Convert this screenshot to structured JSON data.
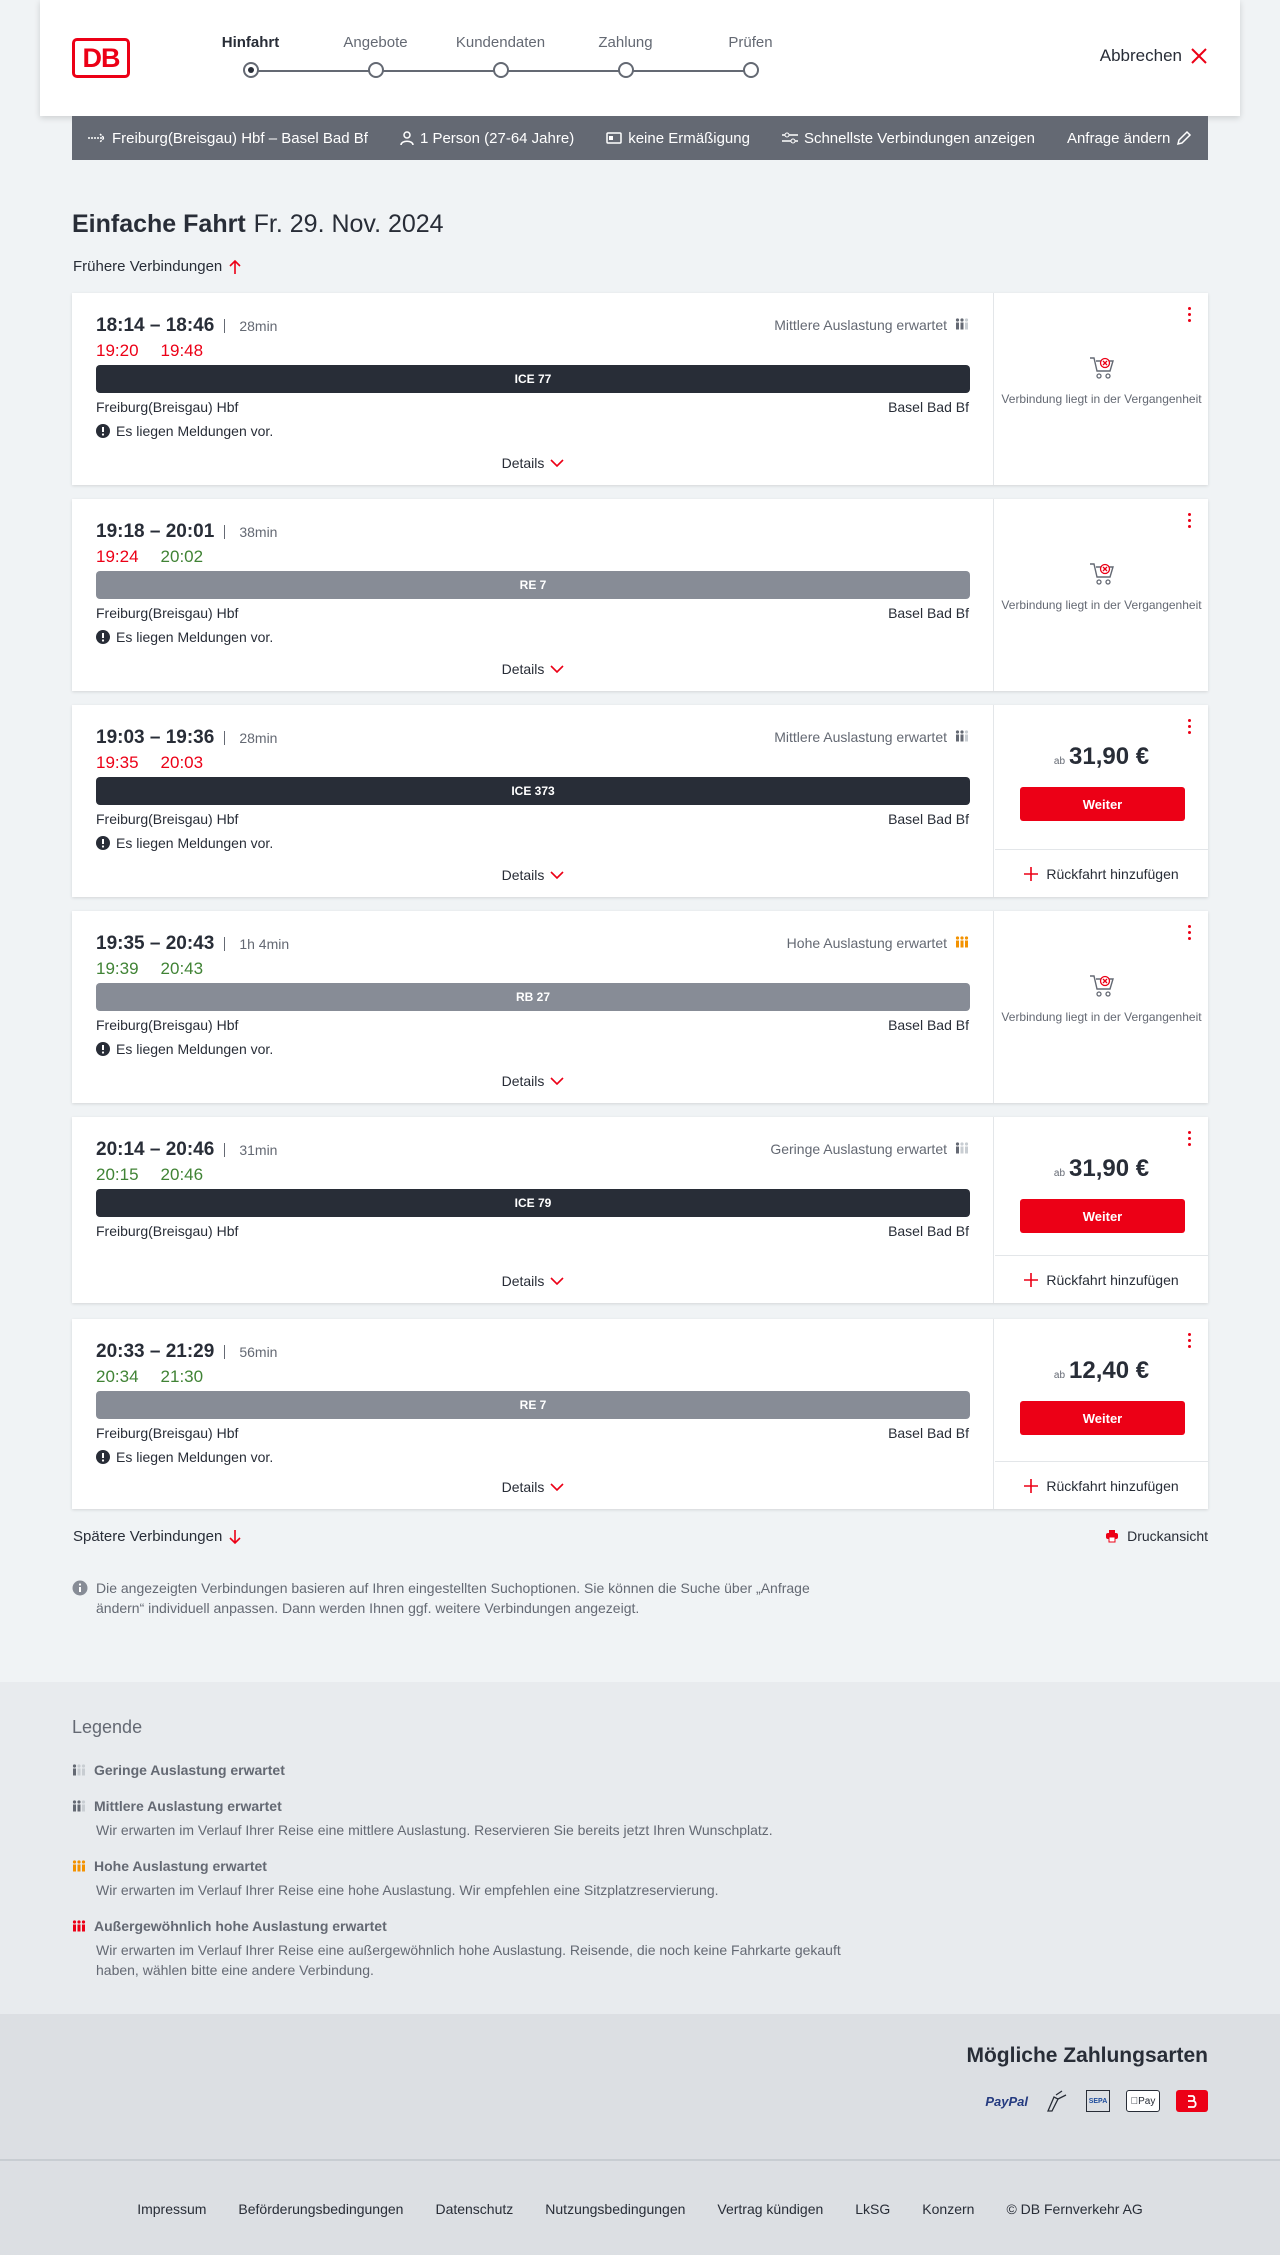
{
  "header": {
    "logo": "DB",
    "steps": [
      "Hinfahrt",
      "Angebote",
      "Kundendaten",
      "Zahlung",
      "Prüfen"
    ],
    "cancel": "Abbrechen"
  },
  "searchbar": {
    "route": "Freiburg(Breisgau) Hbf – Basel Bad Bf",
    "travellers": "1 Person (27-64 Jahre)",
    "discount": "keine Ermäßigung",
    "fastest": "Schnellste Verbindungen anzeigen",
    "edit": "Anfrage ändern"
  },
  "title": {
    "main": "Einfache Fahrt",
    "date": "Fr. 29. Nov. 2024"
  },
  "earlier": "Frühere Verbindungen",
  "later": "Spätere Verbindungen",
  "print": "Druckansicht",
  "labels": {
    "details": "Details",
    "past": "Verbindung liegt in der Vergangenheit",
    "price_prefix": "ab",
    "weiter": "Weiter",
    "return": "Rückfahrt hinzufügen"
  },
  "connections": [
    {
      "times": "18:14 – 18:46",
      "dur": "28min",
      "rt_dep": "19:20",
      "rt_arr": "19:48",
      "dep_color": "red",
      "arr_color": "red",
      "train": "ICE 77",
      "bar": "dark",
      "from": "Freiburg(Breisgau) Hbf",
      "to": "Basel Bad Bf",
      "msg": "Es liegen Meldungen vor.",
      "load": "Mittlere Auslastung erwartet",
      "past": true
    },
    {
      "times": "19:18 – 20:01",
      "dur": "38min",
      "rt_dep": "19:24",
      "rt_arr": "20:02",
      "dep_color": "red",
      "arr_color": "green",
      "train": "RE 7",
      "bar": "grey",
      "from": "Freiburg(Breisgau) Hbf",
      "to": "Basel Bad Bf",
      "msg": "Es liegen Meldungen vor.",
      "load": "",
      "past": true
    },
    {
      "times": "19:03 – 19:36",
      "dur": "28min",
      "rt_dep": "19:35",
      "rt_arr": "20:03",
      "dep_color": "red",
      "arr_color": "red",
      "train": "ICE 373",
      "bar": "dark",
      "from": "Freiburg(Breisgau) Hbf",
      "to": "Basel Bad Bf",
      "msg": "Es liegen Meldungen vor.",
      "load": "Mittlere Auslastung erwartet",
      "past": false,
      "price": "31,90 €"
    },
    {
      "times": "19:35 – 20:43",
      "dur": "1h 4min",
      "rt_dep": "19:39",
      "rt_arr": "20:43",
      "dep_color": "green",
      "arr_color": "green",
      "train": "RB 27",
      "bar": "grey",
      "from": "Freiburg(Breisgau) Hbf",
      "to": "Basel Bad Bf",
      "msg": "Es liegen Meldungen vor.",
      "load": "Hohe Auslastung erwartet",
      "past": true
    },
    {
      "times": "20:14 – 20:46",
      "dur": "31min",
      "rt_dep": "20:15",
      "rt_arr": "20:46",
      "dep_color": "green",
      "arr_color": "green",
      "train": "ICE 79",
      "bar": "dark",
      "from": "Freiburg(Breisgau) Hbf",
      "to": "Basel Bad Bf",
      "msg": "",
      "load": "Geringe Auslastung erwartet",
      "past": false,
      "price": "31,90 €"
    },
    {
      "times": "20:33 – 21:29",
      "dur": "56min",
      "rt_dep": "20:34",
      "rt_arr": "21:30",
      "dep_color": "green",
      "arr_color": "green",
      "train": "RE 7",
      "bar": "grey",
      "from": "Freiburg(Breisgau) Hbf",
      "to": "Basel Bad Bf",
      "msg": "Es liegen Meldungen vor.",
      "load": "",
      "past": false,
      "price": "12,40 €"
    }
  ],
  "note": "Die angezeigten Verbindungen basieren auf Ihren eingestellten Suchoptionen. Sie können die Suche über „Anfrage ändern“ individuell anpassen. Dann werden Ihnen ggf. weitere Verbindungen angezeigt.",
  "legend": {
    "title": "Legende",
    "items": [
      {
        "t": "Geringe Auslastung erwartet",
        "d": ""
      },
      {
        "t": "Mittlere Auslastung erwartet",
        "d": "Wir erwarten im Verlauf Ihrer Reise eine mittlere Auslastung. Reservieren Sie bereits jetzt Ihren Wunschplatz."
      },
      {
        "t": "Hohe Auslastung erwartet",
        "d": "Wir erwarten im Verlauf Ihrer Reise eine hohe Auslastung. Wir empfehlen eine Sitzplatzreservierung."
      },
      {
        "t": "Außergewöhnlich hohe Auslastung erwartet",
        "d": "Wir erwarten im Verlauf Ihrer Reise eine außergewöhnlich hohe Auslastung. Reisende, die noch keine Fahrkarte gekauft haben, wählen bitte eine andere Verbindung."
      }
    ]
  },
  "payment": {
    "title": "Mögliche Zahlungsarten",
    "paypal": "PayPal",
    "sepa": "SEPA",
    "applepay": "Pay"
  },
  "footer": [
    "Impressum",
    "Beförderungsbedingungen",
    "Datenschutz",
    "Nutzungsbedingungen",
    "Vertrag kündigen",
    "LkSG",
    "Konzern",
    "© DB Fernverkehr AG"
  ],
  "colors": {
    "primary": "#ec0016",
    "on_time": "#408335",
    "dark": "#282d37"
  }
}
